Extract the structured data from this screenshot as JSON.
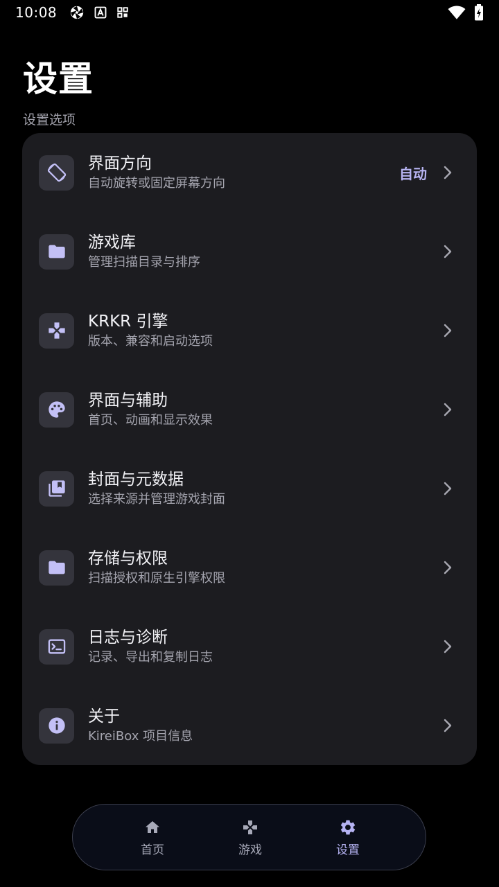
{
  "status_bar": {
    "time": "10:08"
  },
  "header": {
    "title": "设置",
    "section_label": "设置选项"
  },
  "settings": [
    {
      "icon": "screen-rotation-icon",
      "title": "界面方向",
      "subtitle": "自动旋转或固定屏幕方向",
      "value": "自动"
    },
    {
      "icon": "folder-icon",
      "title": "游戏库",
      "subtitle": "管理扫描目录与排序",
      "value": ""
    },
    {
      "icon": "gamepad-icon",
      "title": "KRKR 引擎",
      "subtitle": "版本、兼容和启动选项",
      "value": ""
    },
    {
      "icon": "palette-icon",
      "title": "界面与辅助",
      "subtitle": "首页、动画和显示效果",
      "value": ""
    },
    {
      "icon": "library-books-icon",
      "title": "封面与元数据",
      "subtitle": "选择来源并管理游戏封面",
      "value": ""
    },
    {
      "icon": "folder-icon",
      "title": "存储与权限",
      "subtitle": "扫描授权和原生引擎权限",
      "value": ""
    },
    {
      "icon": "terminal-icon",
      "title": "日志与诊断",
      "subtitle": "记录、导出和复制日志",
      "value": ""
    },
    {
      "icon": "info-icon",
      "title": "关于",
      "subtitle": "KireiBox 项目信息",
      "value": ""
    }
  ],
  "bottom_nav": {
    "items": [
      {
        "icon": "home-icon",
        "label": "首页"
      },
      {
        "icon": "gamepad-icon",
        "label": "游戏"
      },
      {
        "icon": "gear-icon",
        "label": "设置"
      }
    ],
    "active_index": 2
  },
  "colors": {
    "background": "#000000",
    "card": "#1C1C20",
    "icon_tile": "#34343C",
    "accent": "#B7B4F2",
    "nav_bg": "#0A0D18"
  }
}
